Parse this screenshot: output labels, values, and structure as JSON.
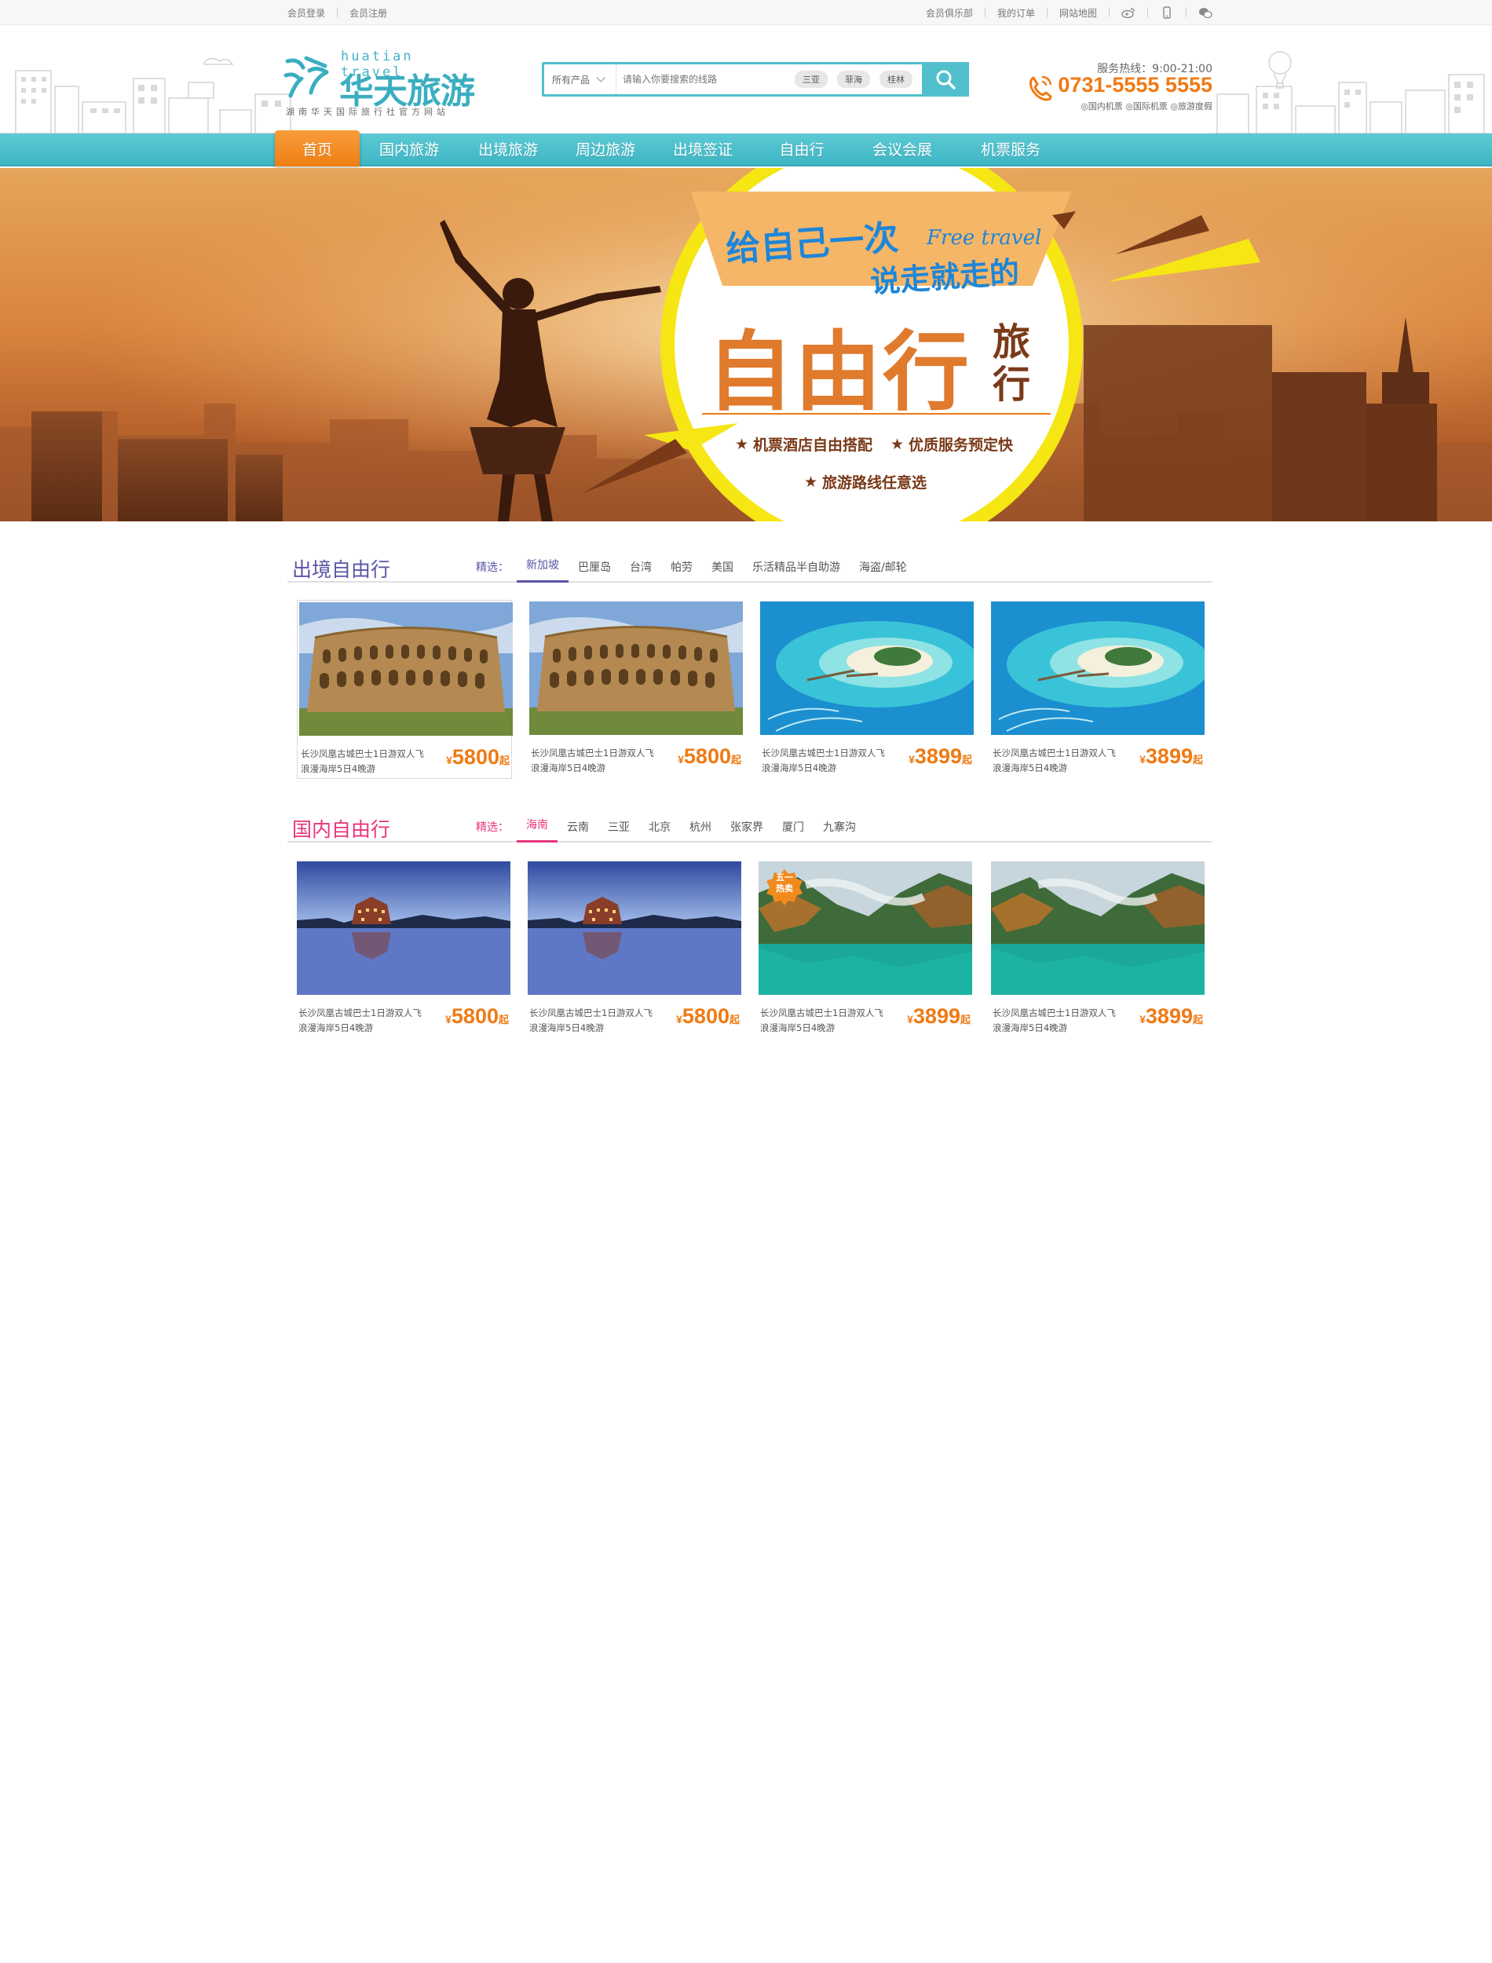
{
  "topbar": {
    "left_links": [
      "会员登录",
      "会员注册"
    ],
    "right_links": [
      "会员俱乐部",
      "我的订单",
      "网站地图"
    ],
    "icons": [
      "weibo-icon",
      "mobile-icon",
      "wechat-icon"
    ]
  },
  "logo": {
    "english": "huatian travel",
    "chinese": "华天旅游",
    "subtitle": "湖南华天国际旅行社官方网站"
  },
  "search": {
    "category": "所有产品",
    "placeholder": "请输入你要搜索的线路",
    "tags": [
      "三亚",
      "菲海",
      "桂林"
    ]
  },
  "hotline": {
    "label": "服务热线：9:00-21:00",
    "number": "0731-5555 5555",
    "services": "◎国内机票 ◎国际机票 ◎旅游度假"
  },
  "nav": {
    "items": [
      "首页",
      "国内旅游",
      "出境旅游",
      "周边旅游",
      "出境签证",
      "自由行",
      "会议会展",
      "机票服务"
    ]
  },
  "banner": {
    "line1": "给自己一次",
    "line2": "说走就走的",
    "english": "Free travel",
    "big": "自由行",
    "side1": "旅",
    "side2": "行",
    "feature1": "机票酒店自由搭配",
    "feature2": "优质服务预定快",
    "feature3": "旅游路线任意选"
  },
  "section1": {
    "title": "出境自由行",
    "filter_label": "精选：",
    "filters": [
      "新加坡",
      "巴厘岛",
      "台湾",
      "帕劳",
      "美国",
      "乐活精品半自助游",
      "海盗/邮轮"
    ],
    "cards": [
      {
        "desc1": "长沙凤凰古城巴士1日游双人飞",
        "desc2": "浪漫海岸5日4晚游",
        "currency": "¥",
        "price": "5800",
        "suffix": "起"
      },
      {
        "desc1": "长沙凤凰古城巴士1日游双人飞",
        "desc2": "浪漫海岸5日4晚游",
        "currency": "¥",
        "price": "5800",
        "suffix": "起"
      },
      {
        "desc1": "长沙凤凰古城巴士1日游双人飞",
        "desc2": "浪漫海岸5日4晚游",
        "currency": "¥",
        "price": "3899",
        "suffix": "起"
      },
      {
        "desc1": "长沙凤凰古城巴士1日游双人飞",
        "desc2": "浪漫海岸5日4晚游",
        "currency": "¥",
        "price": "3899",
        "suffix": "起"
      }
    ]
  },
  "section2": {
    "title": "国内自由行",
    "filter_label": "精选：",
    "filters": [
      "海南",
      "云南",
      "三亚",
      "北京",
      "杭州",
      "张家界",
      "厦门",
      "九寨沟"
    ],
    "cards": [
      {
        "desc1": "长沙凤凰古城巴士1日游双人飞",
        "desc2": "浪漫海岸5日4晚游",
        "currency": "¥",
        "price": "5800",
        "suffix": "起"
      },
      {
        "desc1": "长沙凤凰古城巴士1日游双人飞",
        "desc2": "浪漫海岸5日4晚游",
        "currency": "¥",
        "price": "5800",
        "suffix": "起"
      },
      {
        "desc1": "长沙凤凰古城巴士1日游双人飞",
        "desc2": "浪漫海岸5日4晚游",
        "currency": "¥",
        "price": "3899",
        "suffix": "起"
      },
      {
        "desc1": "长沙凤凰古城巴士1日游双人飞",
        "desc2": "浪漫海岸5日4晚游",
        "currency": "¥",
        "price": "3899",
        "suffix": "起"
      }
    ],
    "badge_line1": "五一",
    "badge_line2": "热卖"
  },
  "colors": {
    "accent": "#52c0cc",
    "orange": "#f07a14",
    "section1_title": "#5a55a6",
    "section2_title": "#e8357a"
  }
}
